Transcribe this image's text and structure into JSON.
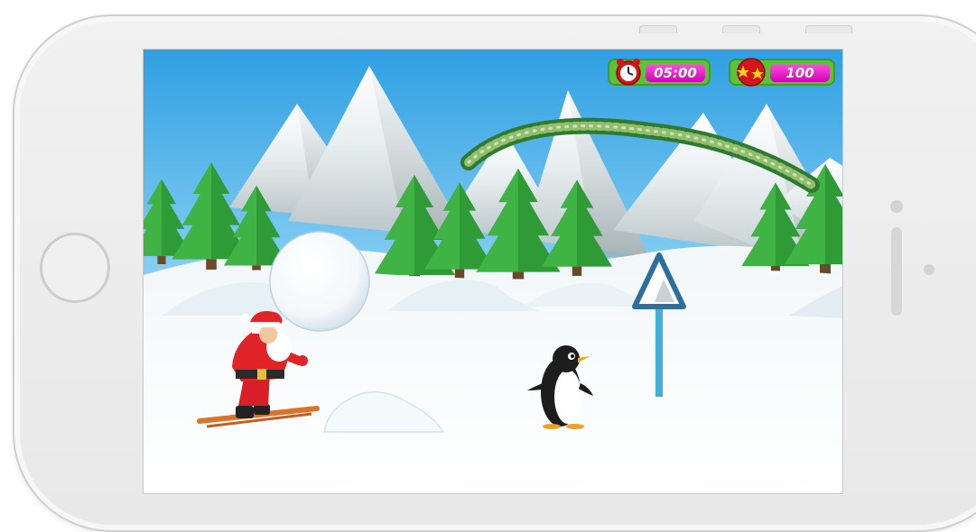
{
  "hud": {
    "timer": "05:00",
    "score": "100",
    "timer_icon": "alarm-clock-icon",
    "score_icon": "stars-icon"
  },
  "scene": {
    "characters": [
      "santa-skier",
      "penguin"
    ],
    "obstacles": [
      "snowball",
      "snow-mound",
      "warning-sign",
      "garland-arch"
    ]
  },
  "colors": {
    "sky_top": "#3aa8e6",
    "sky_bottom": "#d9f1fb",
    "snow": "#ffffff",
    "tree": "#2e9a35",
    "hud_green": "#5cc23a",
    "hud_magenta": "#e01ec7"
  }
}
